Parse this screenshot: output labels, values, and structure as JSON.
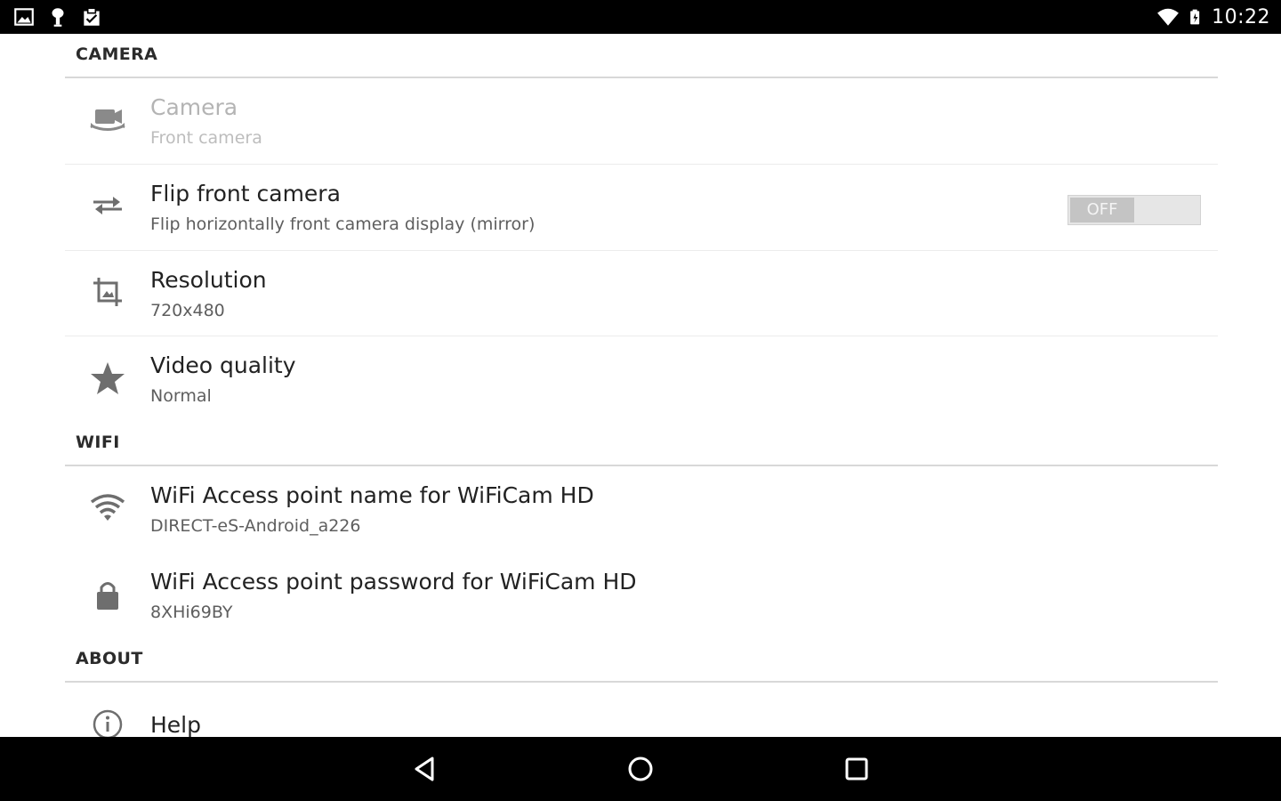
{
  "status_bar": {
    "left_icons": [
      "image-icon",
      "android-debug-icon",
      "clipboard-icon"
    ],
    "right_icons": [
      "wifi-signal-icon",
      "battery-icon"
    ],
    "time": "10:22"
  },
  "sections": {
    "camera": {
      "title": "CAMERA",
      "items": {
        "camera": {
          "title": "Camera",
          "summary": "Front camera",
          "icon": "switch-camera-icon",
          "enabled": false
        },
        "flip": {
          "title": "Flip front camera",
          "summary": "Flip horizontally front camera display (mirror)",
          "icon": "swap-arrows-icon",
          "toggle_label": "OFF",
          "toggle_on": false
        },
        "resolution": {
          "title": "Resolution",
          "summary": "720x480",
          "icon": "crop-icon"
        },
        "quality": {
          "title": "Video quality",
          "summary": "Normal",
          "icon": "star-icon"
        }
      }
    },
    "wifi": {
      "title": "WIFI",
      "items": {
        "ap_name": {
          "title": "WiFi Access point name for WiFiCam HD",
          "summary": "DIRECT-eS-Android_a226",
          "icon": "wifi-icon"
        },
        "ap_password": {
          "title": "WiFi Access point password for WiFiCam HD",
          "summary": "8XHi69BY",
          "icon": "lock-icon"
        }
      }
    },
    "about": {
      "title": "ABOUT",
      "items": {
        "help": {
          "title": "Help",
          "icon": "info-icon"
        }
      }
    }
  },
  "nav_bar": {
    "buttons": [
      "back-icon",
      "home-icon",
      "recents-icon"
    ]
  },
  "colors": {
    "status_bar": "#000000",
    "nav_bar": "#000000",
    "background": "#ffffff",
    "icon": "#7a7a7a"
  }
}
